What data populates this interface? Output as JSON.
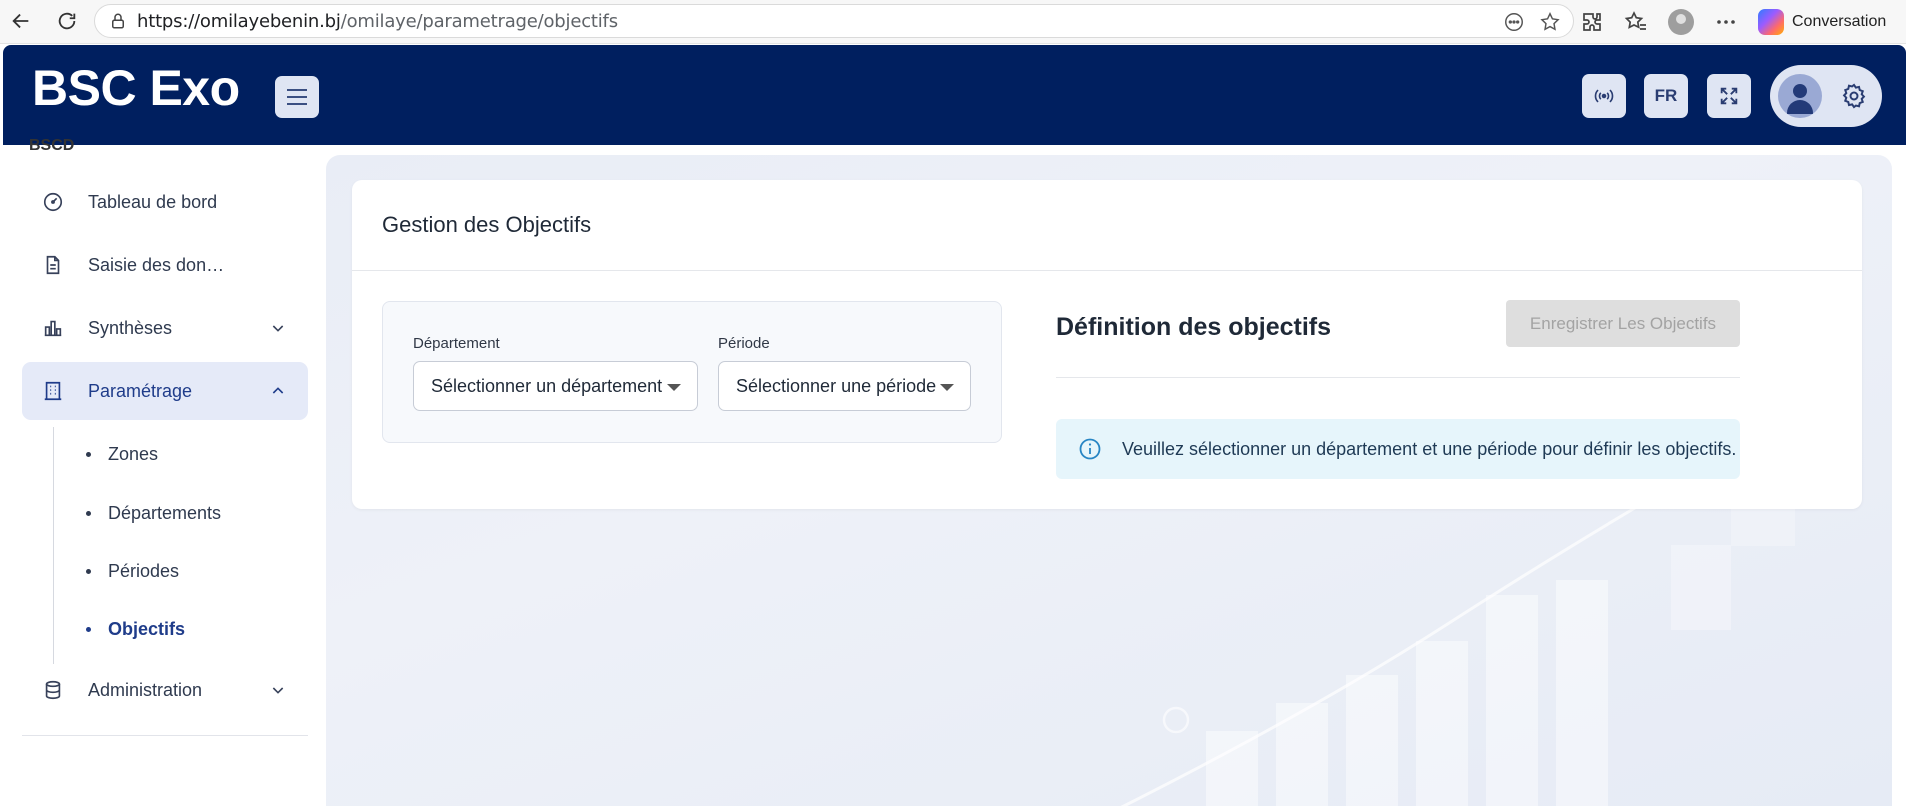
{
  "browser": {
    "url_host": "https://omilayebenin.bj",
    "url_path": "/omilaye/parametrage/objectifs",
    "copilot_label": "Conversation"
  },
  "header": {
    "brand": "BSC Exo",
    "language": "FR"
  },
  "sidebar": {
    "cut_label": "BSCD",
    "items": [
      {
        "label": "Tableau de bord",
        "icon": "gauge-icon"
      },
      {
        "label": "Saisie des don…",
        "icon": "document-icon"
      },
      {
        "label": "Synthèses",
        "icon": "bar-chart-icon"
      },
      {
        "label": "Paramétrage",
        "icon": "building-icon"
      },
      {
        "label": "Administration",
        "icon": "database-icon"
      }
    ],
    "sub_items": [
      "Zones",
      "Départements",
      "Périodes",
      "Objectifs"
    ]
  },
  "main": {
    "card_title": "Gestion des Objectifs",
    "department_label": "Département",
    "department_value": "Sélectionner un département",
    "period_label": "Période",
    "period_value": "Sélectionner une période",
    "definition_title": "Définition des objectifs",
    "save_button": "Enregistrer Les Objectifs",
    "info_message": "Veuillez sélectionner un département et une période pour définir les objectifs."
  },
  "colors": {
    "header_bg": "#001f5f",
    "accent": "#1f3c8a",
    "active_bg": "#e5eaf8",
    "info_bg": "#e6f5fb"
  }
}
